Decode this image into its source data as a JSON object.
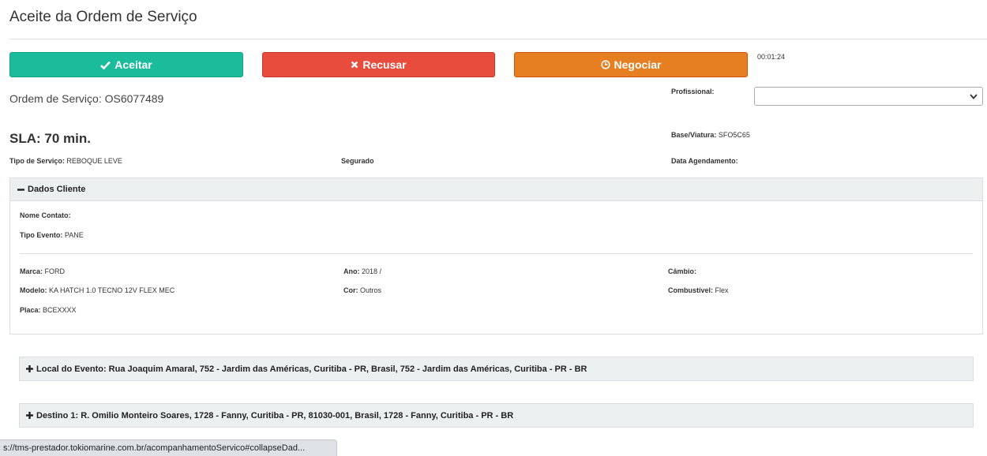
{
  "page": {
    "title": "Aceite da Ordem de Serviço"
  },
  "actions": {
    "accept_label": "Aceitar",
    "refuse_label": "Recusar",
    "negotiate_label": "Negociar",
    "timer": "00:01:24"
  },
  "order": {
    "os_label": "Ordem de Serviço:",
    "os_value": "OS6077489",
    "sla": "SLA: 70 min.",
    "profissional_label": "Profissional:",
    "profissional_value": "",
    "base_label": "Base/Viatura:",
    "base_value": "SFO5C65",
    "tipo_servico_label": "Tipo de Serviço:",
    "tipo_servico_value": "REBOQUE LEVE",
    "segurado_label": "Segurado",
    "data_agendamento_label": "Data Agendamento:"
  },
  "dados_cliente": {
    "title": "Dados Cliente",
    "nome_contato_label": "Nome Contato:",
    "tipo_evento_label": "Tipo Evento:",
    "tipo_evento_value": "PANE",
    "marca_label": "Marca:",
    "marca_value": "FORD",
    "ano_label": "Ano:",
    "ano_value": "2018 /",
    "cambio_label": "Câmbio:",
    "modelo_label": "Modelo:",
    "modelo_value": "KA HATCH 1.0 TECNO 12V FLEX MEC",
    "cor_label": "Cor:",
    "cor_value": "Outros",
    "combustivel_label": "Combustível:",
    "combustivel_value": "Flex",
    "placa_label": "Placa:",
    "placa_value": "BCEXXXX"
  },
  "local_evento": {
    "text": "Local do Evento: Rua Joaquim Amaral, 752 - Jardim das Américas, Curitiba - PR, Brasil, 752 - Jardim das Américas, Curitiba - PR - BR"
  },
  "destino": {
    "text": "Destino 1: R. Omilio Monteiro Soares, 1728 - Fanny, Curitiba - PR, 81030-001, Brasil, 1728 - Fanny, Curitiba - PR - BR"
  },
  "statusbar": {
    "url": "s://tms-prestador.tokiomarine.com.br/acompanhamentoServico#collapseDad..."
  },
  "colors": {
    "accept": "#1abc9c",
    "refuse": "#e74c3c",
    "negotiate": "#e67e22",
    "panel_header": "#ecf0f1"
  },
  "icons": {
    "accept": "check-icon",
    "refuse": "times-icon",
    "negotiate": "clock-icon",
    "collapse": "minus-icon",
    "expand": "plus-icon",
    "select": "chevron-down-icon"
  }
}
